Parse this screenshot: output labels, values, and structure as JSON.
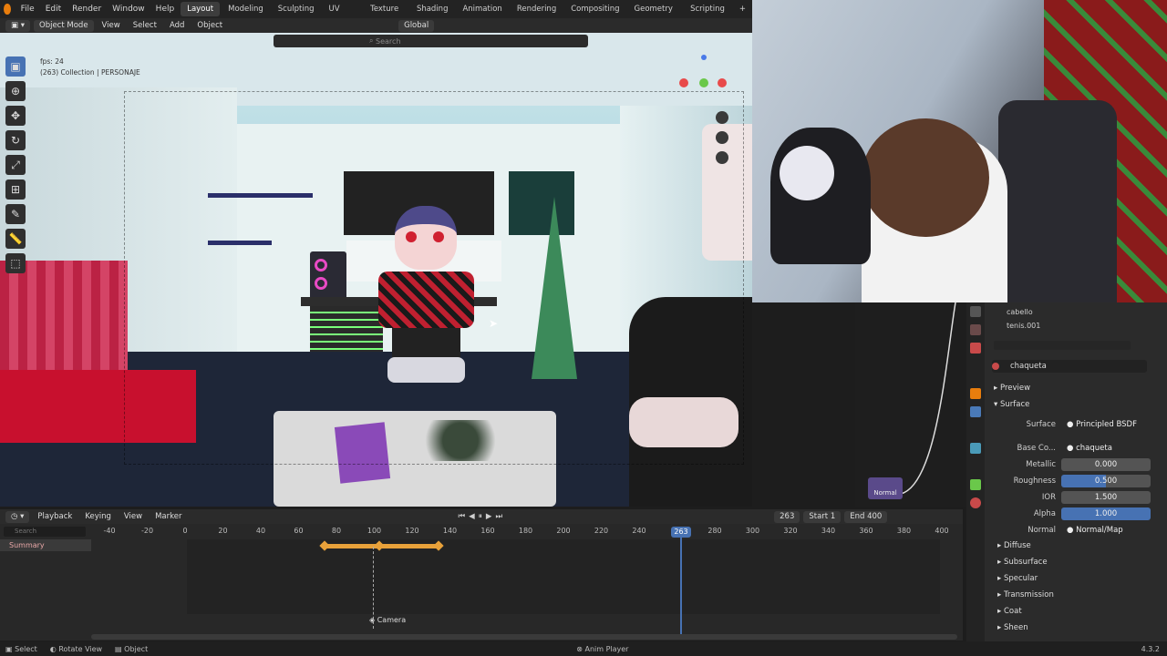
{
  "topbar": {
    "menus": [
      "File",
      "Edit",
      "Render",
      "Window",
      "Help"
    ],
    "workspaces": [
      "Layout",
      "Modeling",
      "Sculpting",
      "UV Editing",
      "Texture Paint",
      "Shading",
      "Animation",
      "Rendering",
      "Compositing",
      "Geometry Nodes",
      "Scripting"
    ],
    "active_workspace": "Layout"
  },
  "header": {
    "mode": "Object Mode",
    "menus": [
      "View",
      "Select",
      "Add",
      "Object"
    ],
    "orientation": "Global",
    "search_placeholder": "Search"
  },
  "viewport": {
    "fps": "fps: 24",
    "collection": "(263) Collection | PERSONAJE"
  },
  "properties": {
    "outliner_items": [
      "cabello",
      "tenis.001"
    ],
    "material": "chaqueta",
    "sections": {
      "preview": "Preview",
      "surface": "Surface"
    },
    "surface_label": "Surface",
    "surface_value": "Principled BSDF",
    "base_color_label": "Base Co...",
    "base_color_value": "chaqueta",
    "metallic_label": "Metallic",
    "metallic_value": "0.000",
    "roughness_label": "Roughness",
    "roughness_value": "0.500",
    "ior_label": "IOR",
    "ior_value": "1.500",
    "alpha_label": "Alpha",
    "alpha_value": "1.000",
    "normal_label": "Normal",
    "normal_value": "Normal/Map",
    "subsections": [
      "Diffuse",
      "Subsurface",
      "Specular",
      "Transmission",
      "Coat",
      "Sheen"
    ]
  },
  "nodes": {
    "normal_label": "Normal"
  },
  "timeline": {
    "menus": [
      "Playback",
      "Keying",
      "View",
      "Marker"
    ],
    "current_frame": "263",
    "start_label": "Start",
    "start_value": "1",
    "end_label": "End",
    "end_value": "400",
    "summary": "Summary",
    "ticks": [
      "-40",
      "-20",
      "0",
      "20",
      "40",
      "60",
      "80",
      "100",
      "120",
      "140",
      "160",
      "180",
      "200",
      "220",
      "240",
      "263",
      "280",
      "300",
      "320",
      "340",
      "360",
      "380",
      "400"
    ],
    "search_placeholder": "Search",
    "marker": "Camera"
  },
  "status": {
    "select": "Select",
    "rotate": "Rotate View",
    "object": "Object",
    "anim": "Anim Player",
    "version": "4.3.2"
  },
  "colors": {
    "accent": "#4772b3",
    "orange": "#e87d0d",
    "keyframe": "#e8a13a"
  }
}
